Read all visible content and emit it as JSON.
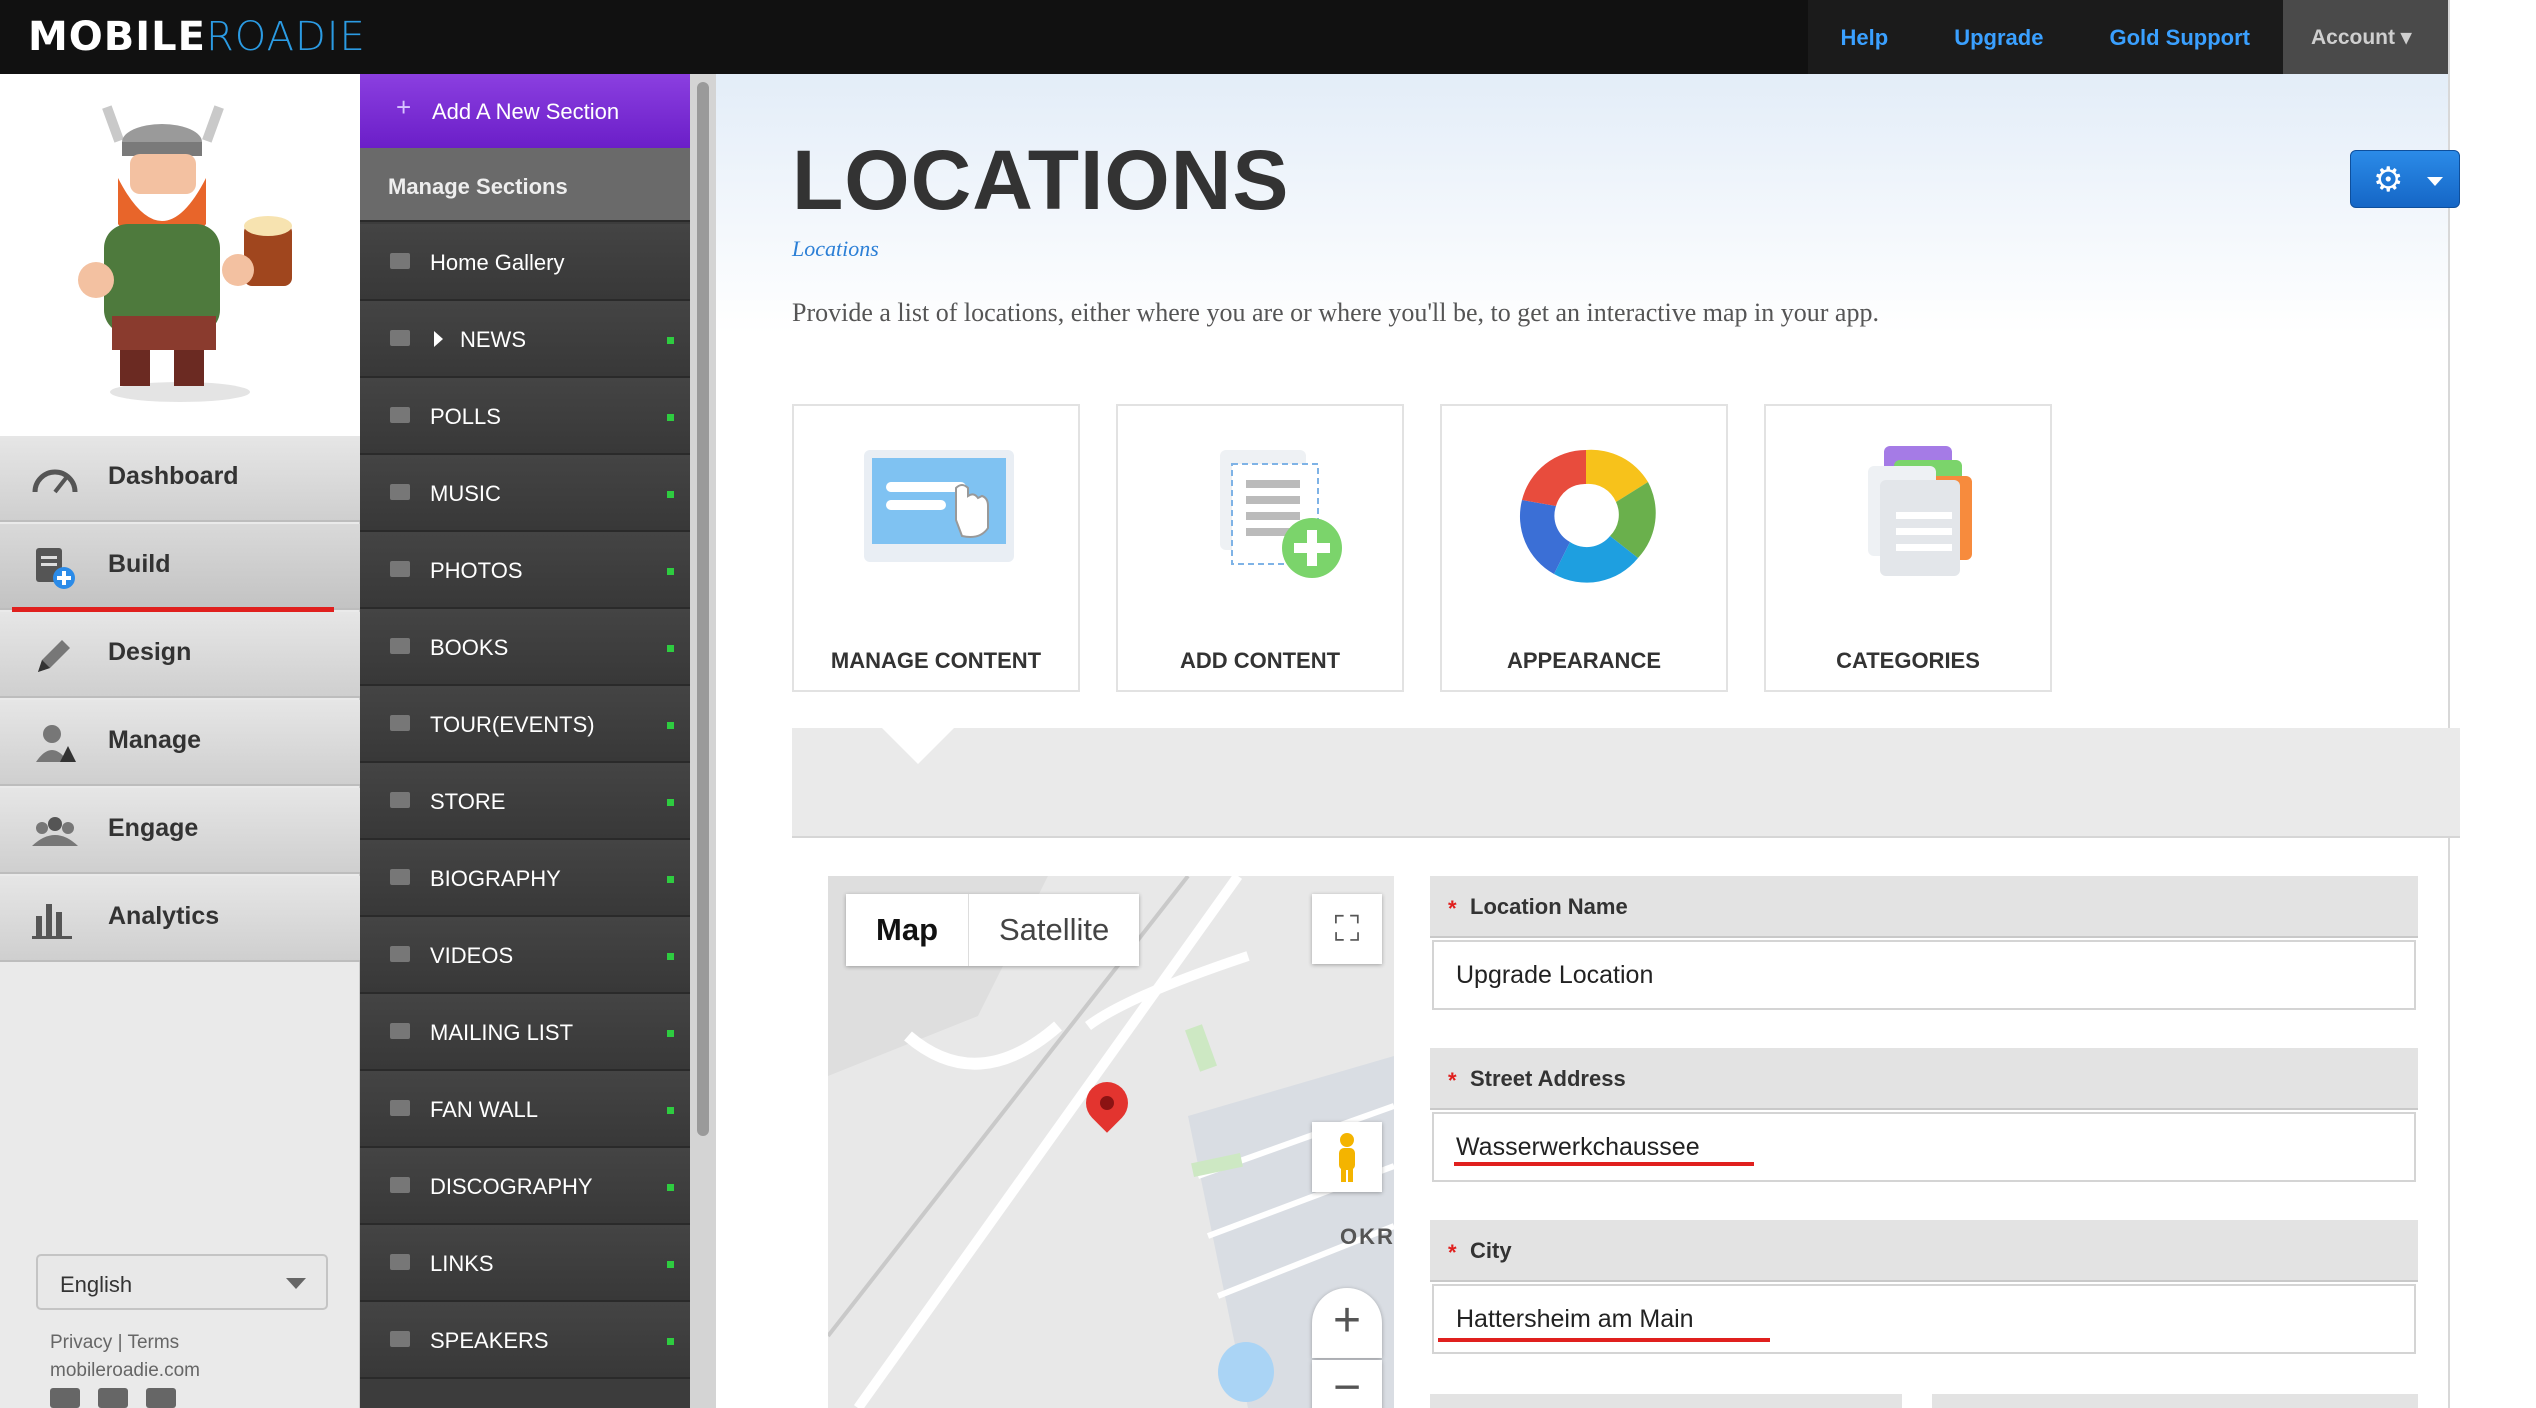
{
  "topbar": {
    "logo_part1": "MOBILE",
    "logo_part2": "ROADIE",
    "nav": [
      {
        "label": "Help"
      },
      {
        "label": "Upgrade"
      },
      {
        "label": "Gold Support"
      },
      {
        "label": "Account ▾"
      }
    ]
  },
  "leftnav": {
    "items": [
      {
        "label": "Dashboard",
        "icon": "speedometer-icon"
      },
      {
        "label": "Build",
        "icon": "build-page-icon",
        "active": true
      },
      {
        "label": "Design",
        "icon": "pencil-icon"
      },
      {
        "label": "Manage",
        "icon": "user-manage-icon"
      },
      {
        "label": "Engage",
        "icon": "people-icon"
      },
      {
        "label": "Analytics",
        "icon": "bar-chart-icon"
      }
    ],
    "language": "English",
    "footer_links": "Privacy | Terms",
    "footer_site": "mobileroadie.com"
  },
  "sections": {
    "add_label": "Add A New Section",
    "manage_label": "Manage Sections",
    "items": [
      {
        "label": "Home Gallery"
      },
      {
        "label": "NEWS"
      },
      {
        "label": "POLLS"
      },
      {
        "label": "MUSIC"
      },
      {
        "label": "PHOTOS"
      },
      {
        "label": "BOOKS"
      },
      {
        "label": "TOUR(EVENTS)"
      },
      {
        "label": "STORE"
      },
      {
        "label": "BIOGRAPHY"
      },
      {
        "label": "VIDEOS"
      },
      {
        "label": "MAILING LIST"
      },
      {
        "label": "FAN WALL"
      },
      {
        "label": "DISCOGRAPHY"
      },
      {
        "label": "LINKS"
      },
      {
        "label": "SPEAKERS"
      }
    ]
  },
  "page": {
    "title": "LOCATIONS",
    "breadcrumb": "Locations",
    "description": "Provide a list of locations, either where you are or where you'll be, to get an interactive map in your app.",
    "cards": [
      {
        "label": "MANAGE CONTENT"
      },
      {
        "label": "ADD CONTENT"
      },
      {
        "label": "APPEARANCE"
      },
      {
        "label": "CATEGORIES"
      }
    ]
  },
  "map": {
    "tab_map": "Map",
    "tab_satellite": "Satellite",
    "district_label": "OKR"
  },
  "form": {
    "location_name_label": "Location Name",
    "location_name_value": "Upgrade Location",
    "street_label": "Street Address",
    "street_value": "Wasserwerkchaussee",
    "city_label": "City",
    "city_value": "Hattersheim am Main",
    "required_mark": "*"
  },
  "colors": {
    "accent_blue": "#2b8be8",
    "purple": "#7a2fd8",
    "required_red": "#e0201e",
    "status_green": "#2ecc40"
  }
}
